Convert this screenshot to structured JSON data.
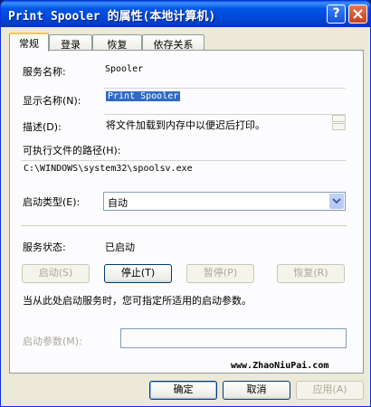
{
  "window": {
    "title": "Print Spooler 的属性(本地计算机)",
    "help_label": "?",
    "close_label": "✕"
  },
  "tabs": [
    {
      "label": "常规"
    },
    {
      "label": "登录"
    },
    {
      "label": "恢复"
    },
    {
      "label": "依存关系"
    }
  ],
  "general": {
    "service_name_label": "服务名称:",
    "service_name_value": "Spooler",
    "display_name_label": "显示名称(N):",
    "display_name_value": "Print Spooler",
    "description_label": "描述(D):",
    "description_value": "将文件加载到内存中以便迟后打印。",
    "exe_path_label": "可执行文件的路径(H):",
    "exe_path_value": "C:\\WINDOWS\\system32\\spoolsv.exe",
    "startup_type_label": "启动类型(E):",
    "startup_type_value": "自动",
    "status_label": "服务状态:",
    "status_value": "已启动",
    "start_button": "启动(S)",
    "stop_button": "停止(T)",
    "pause_button": "暂停(P)",
    "resume_button": "恢复(R)",
    "hint_text": "当从此处启动服务时，您可指定所适用的启动参数。",
    "start_params_label": "启动参数(M):",
    "start_params_value": "",
    "watermark": "www.ZhaoNiuPai.com"
  },
  "footer": {
    "ok_button": "确定",
    "cancel_button": "取消",
    "apply_button": "应用(A)"
  },
  "colors": {
    "title_bar": "#0055e5",
    "selection": "#316ac5",
    "close_button": "#c7401d",
    "active_tab_accent": "#ffc83c"
  }
}
